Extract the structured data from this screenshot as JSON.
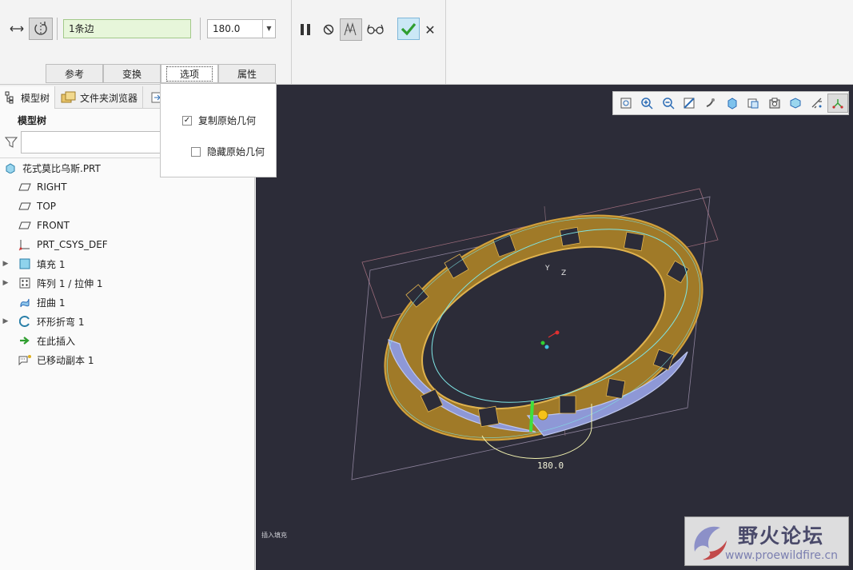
{
  "ribbon": {
    "edge_field_value": "1条边",
    "angle_value": "180.0",
    "tabs": [
      {
        "label": "参考"
      },
      {
        "label": "变换"
      },
      {
        "label": "选项"
      },
      {
        "label": "属性"
      }
    ],
    "active_tab": "选项",
    "confirm_color": "#2f9e2f"
  },
  "options_panel": {
    "copy_original": {
      "label": "复制原始几何",
      "checked": true
    },
    "hide_original": {
      "label": "隐藏原始几何",
      "checked": false
    }
  },
  "left_pane": {
    "tabs": [
      {
        "label": "模型树"
      },
      {
        "label": "文件夹浏览器"
      }
    ],
    "tree_title": "模型树",
    "filter_placeholder": "",
    "items": [
      {
        "label": "花式莫比乌斯.PRT",
        "icon": "part-icon",
        "expandable": false,
        "indent": 0
      },
      {
        "label": "RIGHT",
        "icon": "datum-plane-icon",
        "expandable": false,
        "indent": 1
      },
      {
        "label": "TOP",
        "icon": "datum-plane-icon",
        "expandable": false,
        "indent": 1
      },
      {
        "label": "FRONT",
        "icon": "datum-plane-icon",
        "expandable": false,
        "indent": 1
      },
      {
        "label": "PRT_CSYS_DEF",
        "icon": "csys-icon",
        "expandable": false,
        "indent": 1
      },
      {
        "label": "填充 1",
        "icon": "fill-icon",
        "expandable": true,
        "indent": 1
      },
      {
        "label": "阵列 1 / 拉伸 1",
        "icon": "pattern-icon",
        "expandable": true,
        "indent": 1
      },
      {
        "label": "扭曲 1",
        "icon": "warp-icon",
        "expandable": false,
        "indent": 1
      },
      {
        "label": "环形折弯 1",
        "icon": "toroidal-bend-icon",
        "expandable": true,
        "indent": 1
      },
      {
        "label": "在此插入",
        "icon": "insert-here-arrow-icon",
        "expandable": false,
        "indent": 1
      },
      {
        "label": "已移动副本 1",
        "icon": "moved-copy-icon",
        "expandable": false,
        "indent": 1
      }
    ]
  },
  "viewport": {
    "background": "#2c2c38",
    "csys_labels": {
      "y": "Y",
      "z": "Z"
    },
    "angle_dimension": "180.0",
    "insert_hint": "插入填充",
    "model_colors": {
      "outer": "#c8962a",
      "inner": "#9aa6e0",
      "edges": "#7fe6e6"
    }
  },
  "watermark": {
    "title": "野火论坛",
    "url": "www.proewildfire.cn"
  }
}
